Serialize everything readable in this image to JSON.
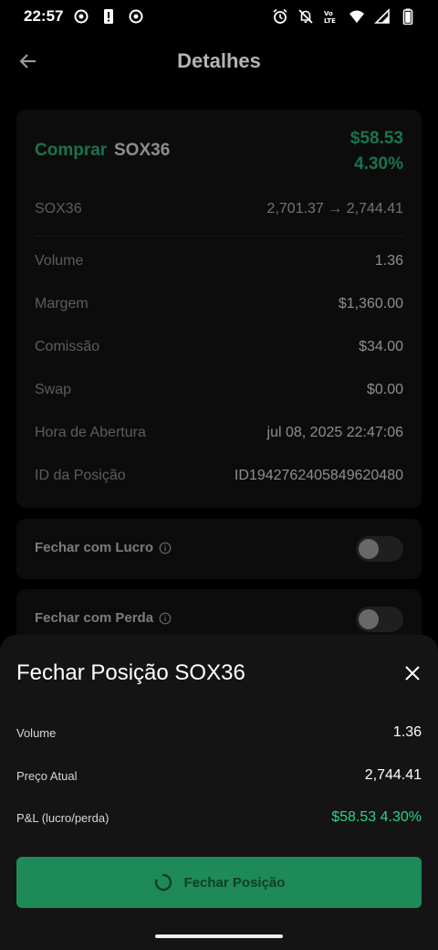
{
  "status_bar": {
    "time": "22:57",
    "left_icons": [
      "notification-dot-icon",
      "battery-alert-icon",
      "notification-dot-icon"
    ],
    "right_icons": [
      "alarm-icon",
      "bell-off-icon",
      "volte-icon",
      "wifi-icon",
      "signal-icon",
      "battery-icon"
    ]
  },
  "header": {
    "title": "Detalhes",
    "back_icon": "arrow-left-icon"
  },
  "summary": {
    "side": "Comprar",
    "symbol": "SOX36",
    "pnl_amount": "$58.53",
    "pnl_percent": "4.30%",
    "price_label": "SOX36",
    "price_value": "2,701.37 → 2,744.41",
    "rows": [
      {
        "label": "Volume",
        "value": "1.36"
      },
      {
        "label": "Margem",
        "value": "$1,360.00"
      },
      {
        "label": "Comissão",
        "value": "$34.00"
      },
      {
        "label": "Swap",
        "value": "$0.00"
      },
      {
        "label": "Hora de Abertura",
        "value": "jul 08, 2025 22:47:06"
      },
      {
        "label": "ID da Posição",
        "value": "ID1942762405849620480"
      }
    ]
  },
  "toggles": [
    {
      "label": "Fechar com Lucro",
      "on": false
    },
    {
      "label": "Fechar com Perda",
      "on": false
    }
  ],
  "sheet": {
    "title": "Fechar Posição SOX36",
    "rows": [
      {
        "label": "Volume",
        "value": "1.36"
      },
      {
        "label": "Preço Atual",
        "value": "2,744.41"
      },
      {
        "label": "P&L (lucro/perda)",
        "value": "$58.53 4.30%"
      }
    ],
    "button_label": "Fechar Posição"
  },
  "colors": {
    "positive": "#2fd28a",
    "button": "#1d8a57",
    "background": "#000000",
    "card": "#161616"
  }
}
